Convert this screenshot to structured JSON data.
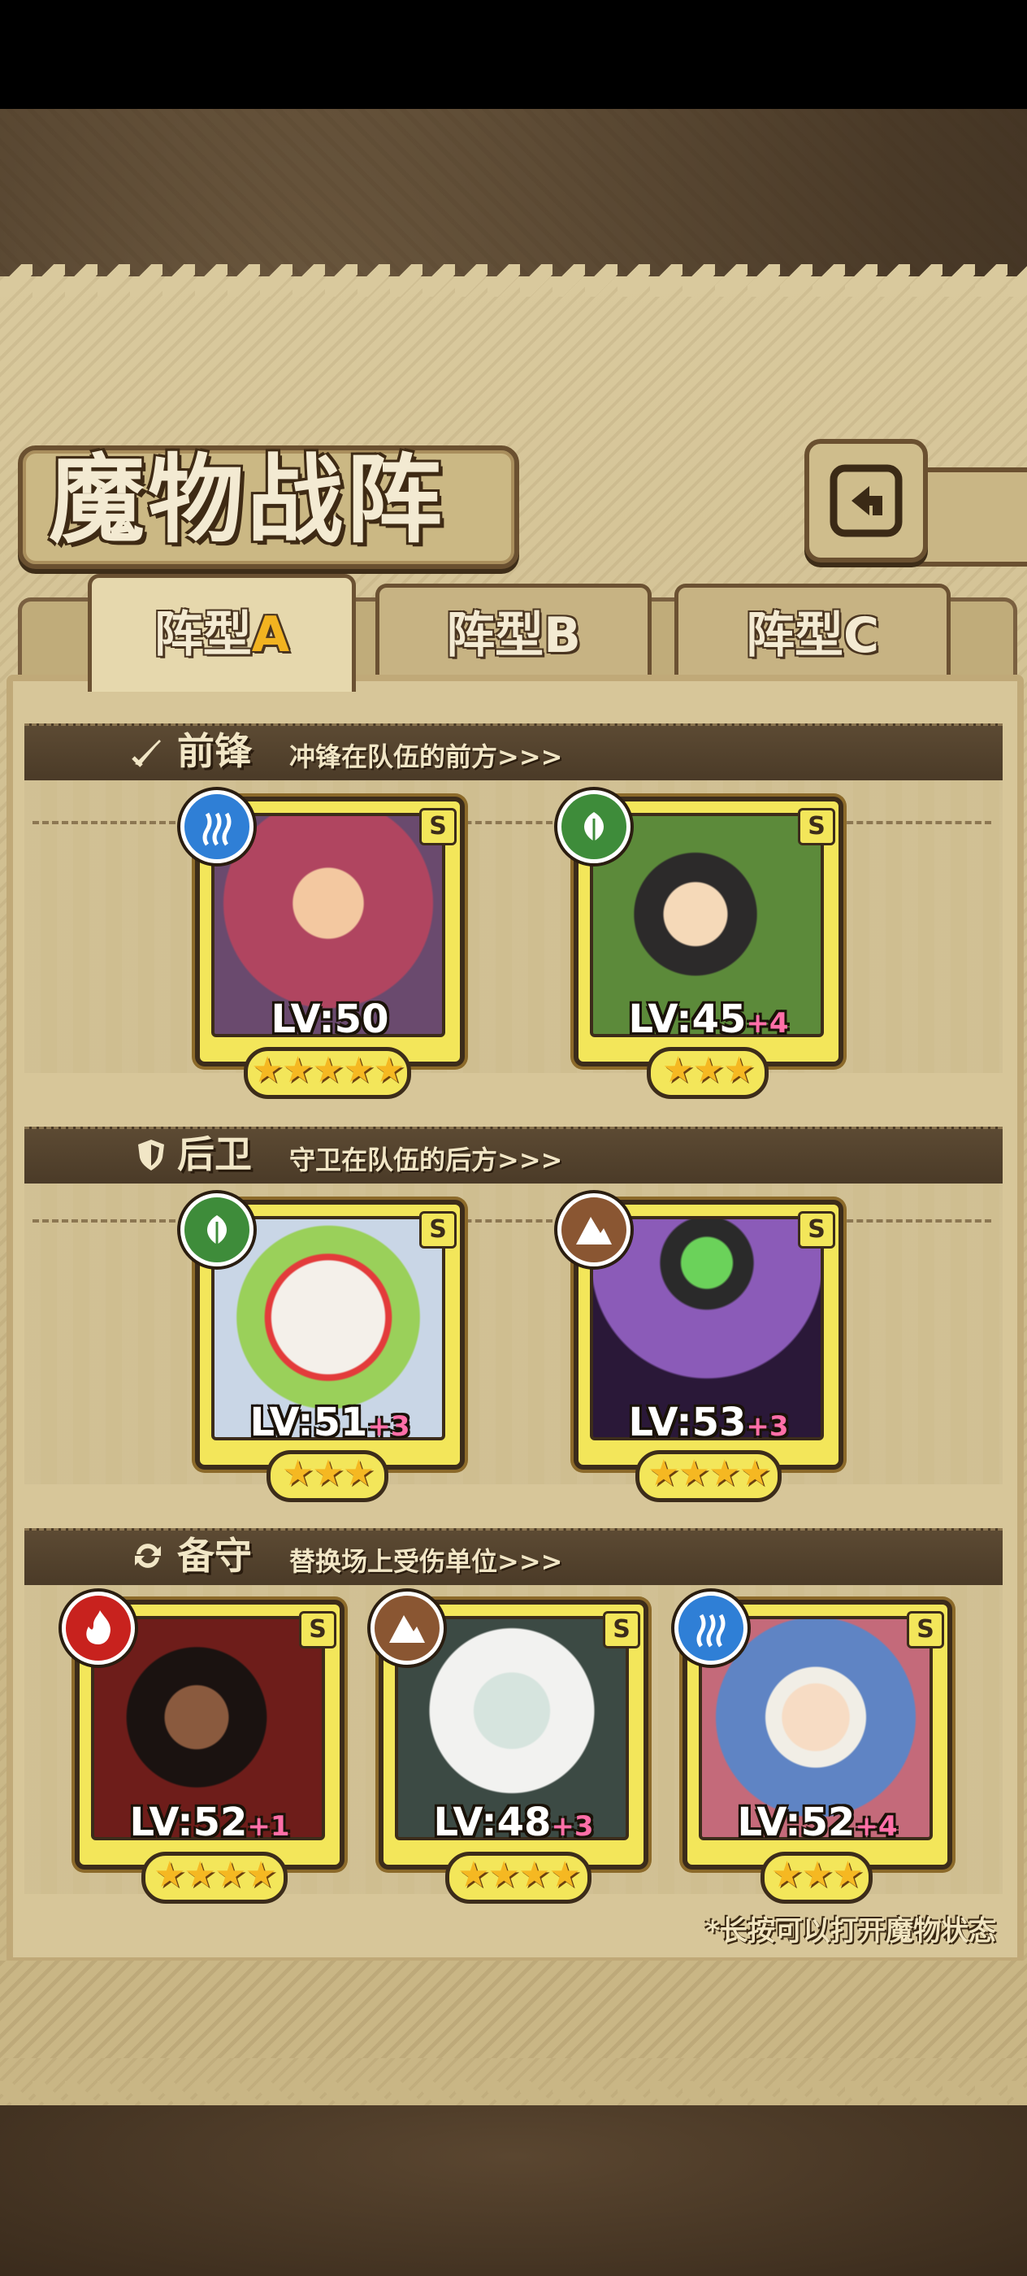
{
  "title": "魔物战阵",
  "back_button": {
    "icon": "return-icon"
  },
  "tabs": [
    {
      "label": "阵型",
      "letter": "A",
      "active": true
    },
    {
      "label": "阵型",
      "letter": "B",
      "active": false
    },
    {
      "label": "阵型",
      "letter": "C",
      "active": false
    }
  ],
  "sections": {
    "vanguard": {
      "title": "前锋",
      "desc": "冲锋在队伍的前方>>>",
      "icon": "sword-icon"
    },
    "rearguard": {
      "title": "后卫",
      "desc": "守卫在队伍的后方>>>",
      "icon": "shield-icon"
    },
    "reserve": {
      "title": "备守",
      "desc": "替换场上受伤单位>>>",
      "icon": "swap-icon"
    }
  },
  "monsters": {
    "vanguard": [
      {
        "element": "water",
        "element_color": "#2f7fd6",
        "rank": "S",
        "level": "LV:50",
        "bonus": "",
        "stars": "★★★★★",
        "portrait_color": "#b04560"
      },
      {
        "element": "wood",
        "element_color": "#3e8c3a",
        "rank": "S",
        "level": "LV:45",
        "bonus": "+4",
        "stars": "★★★",
        "portrait_color": "#5c8a3a"
      }
    ],
    "rearguard": [
      {
        "element": "wood",
        "element_color": "#3e8c3a",
        "rank": "S",
        "level": "LV:51",
        "bonus": "+3",
        "stars": "★★★",
        "portrait_color": "#dfe6e0"
      },
      {
        "element": "earth",
        "element_color": "#8a5632",
        "rank": "S",
        "level": "LV:53",
        "bonus": "+3",
        "stars": "★★★★",
        "portrait_color": "#4a2f66"
      }
    ],
    "reserve": [
      {
        "element": "fire",
        "element_color": "#c8221e",
        "rank": "S",
        "level": "LV:52",
        "bonus": "+1",
        "stars": "★★★★",
        "portrait_color": "#6e1d1a"
      },
      {
        "element": "earth",
        "element_color": "#8a5632",
        "rank": "S",
        "level": "LV:48",
        "bonus": "+3",
        "stars": "★★★★",
        "portrait_color": "#7c8f86"
      },
      {
        "element": "water",
        "element_color": "#2f7fd6",
        "rank": "S",
        "level": "LV:52",
        "bonus": "+4",
        "stars": "★★★",
        "portrait_color": "#5f84c4"
      }
    ]
  },
  "footnote": "*长按可以打开魔物状态"
}
